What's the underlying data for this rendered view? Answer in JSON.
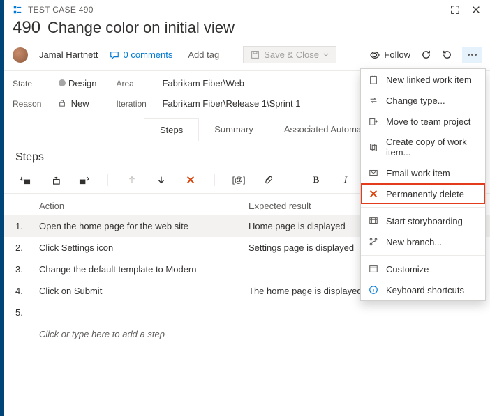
{
  "header": {
    "type_label": "TEST CASE 490",
    "id": "490",
    "title": "Change color on initial view"
  },
  "meta": {
    "author": "Jamal Hartnett",
    "comments_label": "0 comments",
    "add_tag_label": "Add tag",
    "save_label": "Save & Close",
    "follow_label": "Follow"
  },
  "fields": {
    "state_label": "State",
    "state_value": "Design",
    "reason_label": "Reason",
    "reason_value": "New",
    "area_label": "Area",
    "area_value": "Fabrikam Fiber\\Web",
    "iteration_label": "Iteration",
    "iteration_value": "Fabrikam Fiber\\Release 1\\Sprint 1"
  },
  "tabs": [
    "Steps",
    "Summary",
    "Associated Automation"
  ],
  "steps_heading": "Steps",
  "col_action": "Action",
  "col_expected": "Expected result",
  "steps": [
    {
      "n": "1.",
      "action": "Open the home page for the web site",
      "expected": "Home page is displayed"
    },
    {
      "n": "2.",
      "action": "Click Settings icon",
      "expected": "Settings page is displayed"
    },
    {
      "n": "3.",
      "action": "Change the default template to Modern",
      "expected": ""
    },
    {
      "n": "4.",
      "action": "Click on Submit",
      "expected": "The home page is displayed with the Modern look"
    },
    {
      "n": "5.",
      "action": "",
      "expected": ""
    }
  ],
  "step_placeholder": "Click or type here to add a step",
  "toolbar_at": "[@]",
  "menu": {
    "new_linked": "New linked work item",
    "change_type": "Change type...",
    "move_team": "Move to team project",
    "create_copy": "Create copy of work item...",
    "email": "Email work item",
    "perm_delete": "Permanently delete",
    "storyboard": "Start storyboarding",
    "new_branch": "New branch...",
    "customize": "Customize",
    "shortcuts": "Keyboard shortcuts"
  }
}
